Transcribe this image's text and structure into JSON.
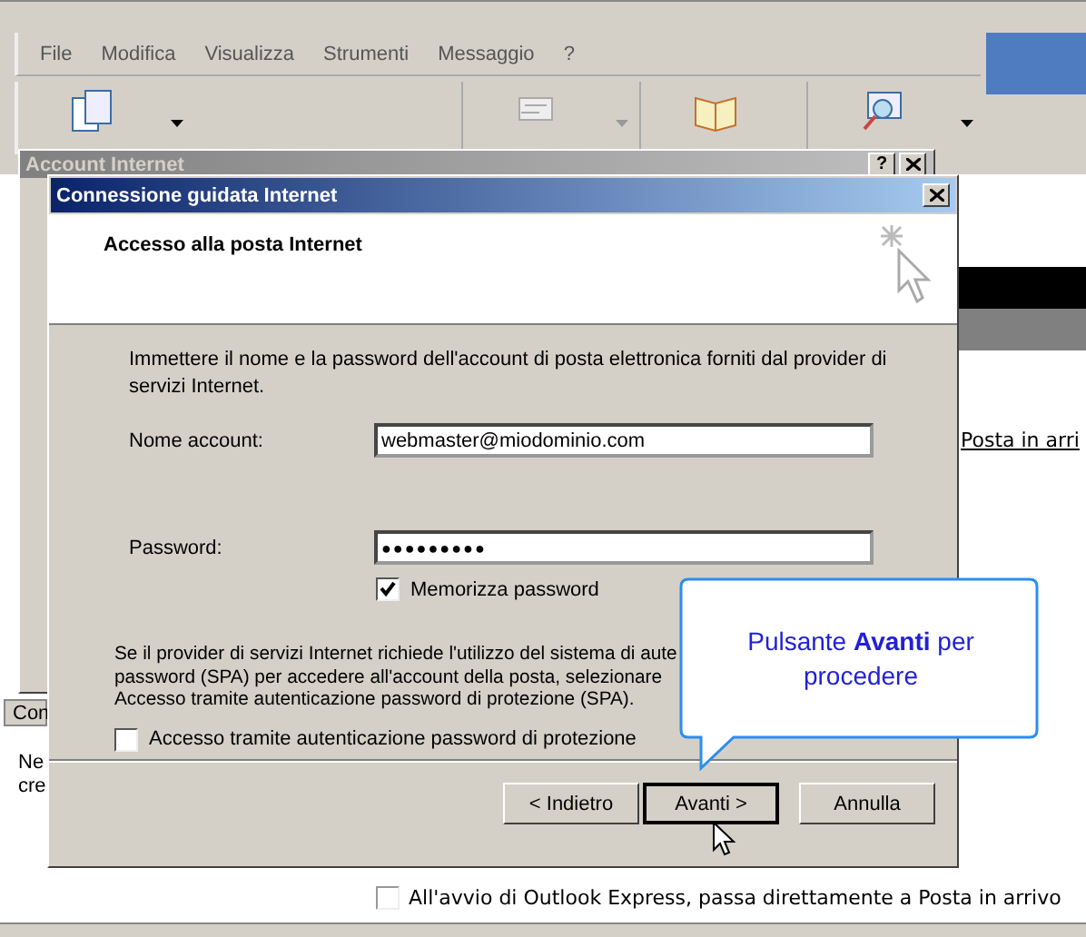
{
  "menu": [
    {
      "label": "File"
    },
    {
      "label": "Modifica"
    },
    {
      "label": "Visualizza"
    },
    {
      "label": "Strumenti"
    },
    {
      "label": "Messaggio"
    },
    {
      "label": "?"
    }
  ],
  "toolbar": [
    {
      "kind": "new",
      "disabled": false,
      "dropdown": true
    },
    {
      "kind": "sendreceive",
      "disabled": true,
      "dropdown": true
    },
    {
      "kind": "addressbook",
      "disabled": false,
      "dropdown": false
    },
    {
      "kind": "find",
      "disabled": false,
      "dropdown": true
    }
  ],
  "account_window": {
    "title": "Account Internet",
    "help": "?"
  },
  "wizard": {
    "title": "Connessione guidata Internet",
    "heading": "Accesso alla posta Internet",
    "intro": "Immettere il nome e la password dell'account di posta elettronica forniti dal provider di servizi Internet.",
    "fields": [
      {
        "label": "Nome account:",
        "value": "webmaster@miodominio.com",
        "kind": "text"
      },
      {
        "label": "Password:",
        "value": "●●●●●●●●●",
        "kind": "password"
      }
    ],
    "remember": {
      "label": "Memorizza password",
      "checked": true
    },
    "spa_lines": [
      "Se il provider di servizi Internet richiede l'utilizzo del sistema di aute",
      "password (SPA) per accedere all'account della posta, selezionare",
      "Accesso tramite autenticazione password di protezione (SPA)."
    ],
    "spa": {
      "label": "Accesso tramite autenticazione password di protezione",
      "checked": false
    },
    "buttons": [
      {
        "label": "< Indietro",
        "focused": false
      },
      {
        "label": "Avanti >",
        "focused": true
      },
      {
        "label": "Annulla",
        "focused": false
      }
    ]
  },
  "callout": {
    "text": "Pulsante **Avanti** per procedere"
  },
  "background": {
    "inbox_link": "Posta in arri",
    "left_tab": "Con",
    "left_lines": [
      "Ne",
      "cre"
    ],
    "startup": {
      "label": "All'avvio di Outlook Express, passa direttamente a Posta in arrivo",
      "checked": false
    }
  }
}
